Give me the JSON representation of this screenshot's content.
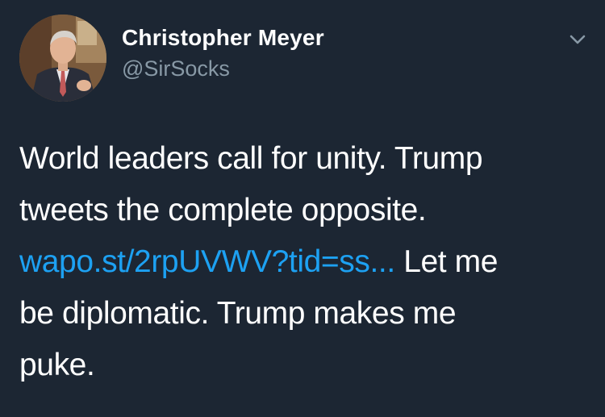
{
  "author": {
    "display_name": "Christopher Meyer",
    "handle": "@SirSocks"
  },
  "icons": {
    "menu_caret": "chevron-down-icon",
    "avatar": "profile-photo"
  },
  "tweet": {
    "line1": "World leaders call for unity. Trump",
    "line2": "tweets the complete opposite.",
    "link": "wapo.st/2rpUVWV?tid=ss...",
    "after_link": " Let me",
    "line4": "be diplomatic. Trump makes me",
    "line5": "puke."
  },
  "colors": {
    "background": "#1c2633",
    "text": "#ffffff",
    "muted": "#8899a6",
    "link": "#1da1f2"
  }
}
